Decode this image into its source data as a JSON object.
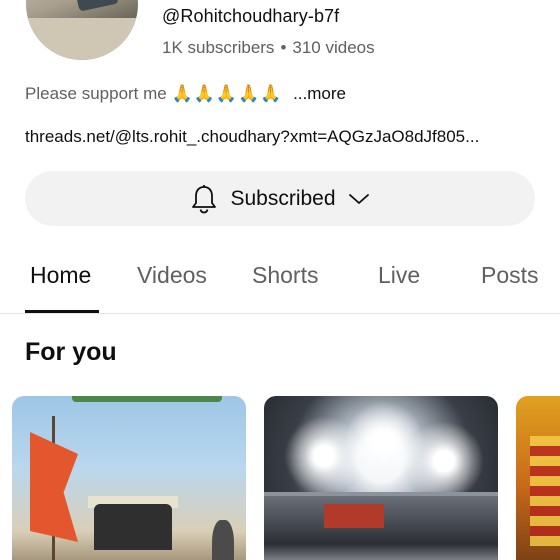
{
  "channel": {
    "handle": "@Rohitchoudhary-b7f",
    "subscribers": "1K subscribers",
    "separator": "•",
    "videos": "310 videos",
    "description": "Please support me",
    "description_emoji": "🙏🙏🙏🙏🙏",
    "more_label": "...more",
    "link": "threads.net/@lts.rohit_.choudhary?xmt=AQGzJaO8dJf805..."
  },
  "subscribe_button": {
    "label": "Subscribed",
    "icon": "bell-icon",
    "chevron_icon": "chevron-down-icon"
  },
  "tabs": [
    {
      "label": "Home",
      "active": true
    },
    {
      "label": "Videos",
      "active": false
    },
    {
      "label": "Shorts",
      "active": false
    },
    {
      "label": "Live",
      "active": false
    },
    {
      "label": "Posts",
      "active": false
    }
  ],
  "section": {
    "title": "For you"
  },
  "colors": {
    "text_primary": "#0f0f0f",
    "text_secondary": "#606060",
    "button_bg": "#f2f2f2",
    "divider": "#e5e5e5"
  }
}
